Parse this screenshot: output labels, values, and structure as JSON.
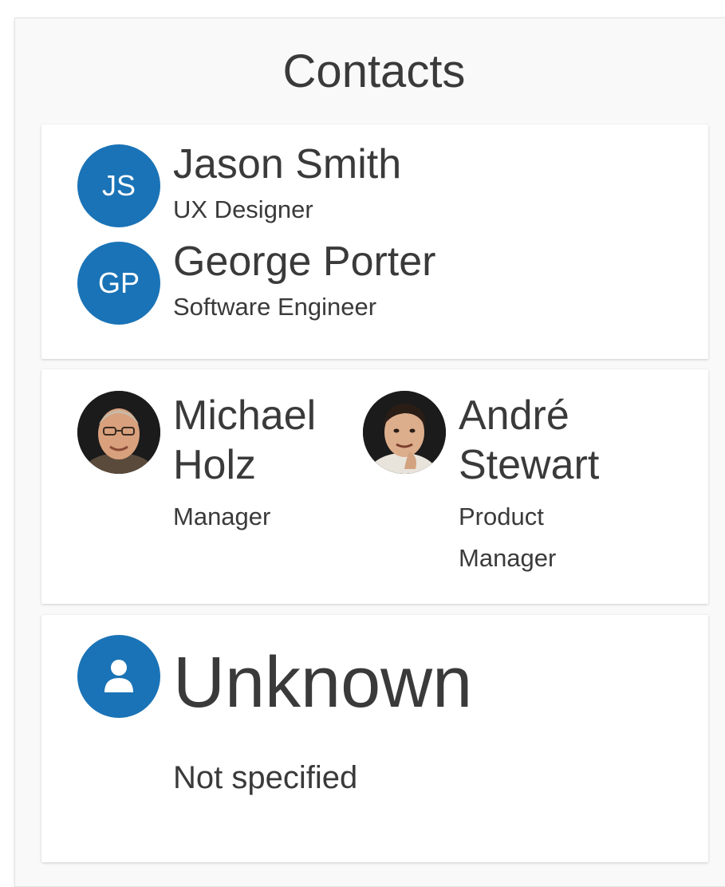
{
  "panel": {
    "title": "Contacts"
  },
  "colors": {
    "accent": "#1a73b6",
    "text": "#3a3a3a",
    "card": "#ffffff",
    "panel": "#f9f9f9"
  },
  "cards": [
    {
      "contacts": [
        {
          "initials": "JS",
          "name": "Jason Smith",
          "role": "UX Designer",
          "avatar_type": "initials"
        },
        {
          "initials": "GP",
          "name": "George Porter",
          "role": "Software Engineer",
          "avatar_type": "initials"
        }
      ]
    },
    {
      "contacts": [
        {
          "name_line1": "Michael",
          "name_line2": "Holz",
          "role": "Manager",
          "avatar_type": "photo"
        },
        {
          "name_line1": "André",
          "name_line2": "Stewart",
          "role_line1": "Product",
          "role_line2": "Manager",
          "avatar_type": "photo"
        }
      ]
    },
    {
      "contacts": [
        {
          "name": "Unknown",
          "role": "Not specified",
          "avatar_type": "person-icon"
        }
      ]
    }
  ]
}
